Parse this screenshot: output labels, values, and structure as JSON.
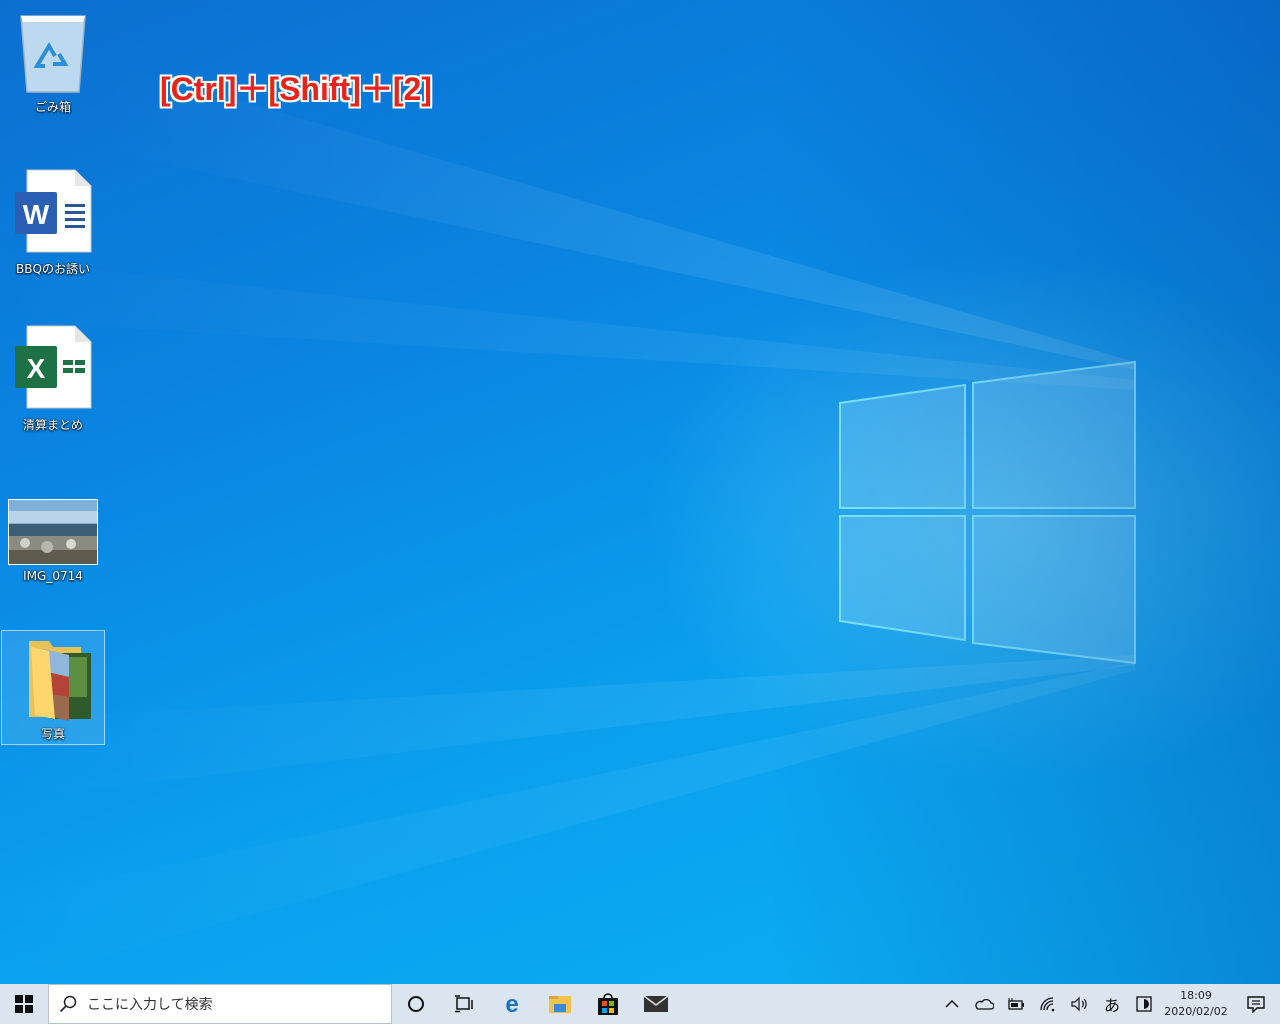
{
  "annotation": {
    "text": "[Ctrl]＋[Shift]＋[2]",
    "color": "#e8231c"
  },
  "desktop_icons": [
    {
      "label": "ごみ箱",
      "icon": "recycle-bin-icon"
    },
    {
      "label": "BBQのお誘い",
      "icon": "word-document-icon"
    },
    {
      "label": "清算まとめ",
      "icon": "excel-workbook-icon"
    },
    {
      "label": "IMG_0714",
      "icon": "photo-thumbnail-icon"
    },
    {
      "label": "写真",
      "icon": "photo-folder-icon",
      "selected": true
    }
  ],
  "taskbar": {
    "search_placeholder": "ここに入力して検索",
    "pinned": [
      "cortana-icon",
      "task-view-icon",
      "edge-icon",
      "file-explorer-icon",
      "store-icon",
      "mail-icon"
    ],
    "tray": {
      "ime": "あ",
      "time": "18:09",
      "date": "2020/02/02"
    }
  },
  "colors": {
    "taskbar_bg": "#dbe5ef",
    "wallpaper_blue": "#0a86e2"
  }
}
